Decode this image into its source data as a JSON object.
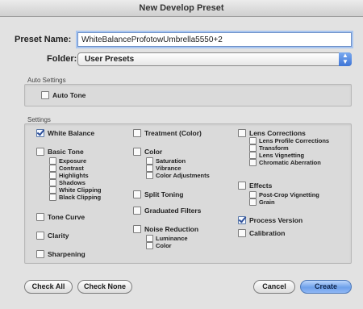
{
  "window": {
    "title": "New Develop Preset"
  },
  "preset_name": {
    "label": "Preset Name:",
    "value": "WhiteBalanceProfotowUmbrella5550+2"
  },
  "folder": {
    "label": "Folder:",
    "value": "User Presets"
  },
  "auto_settings": {
    "title": "Auto Settings",
    "auto_tone": "Auto Tone"
  },
  "settings": {
    "title": "Settings",
    "white_balance": "White Balance",
    "basic_tone": "Basic Tone",
    "exposure": "Exposure",
    "contrast": "Contrast",
    "highlights": "Highlights",
    "shadows": "Shadows",
    "white_clipping": "White Clipping",
    "black_clipping": "Black Clipping",
    "tone_curve": "Tone Curve",
    "clarity": "Clarity",
    "sharpening": "Sharpening",
    "treatment": "Treatment (Color)",
    "color": "Color",
    "saturation": "Saturation",
    "vibrance": "Vibrance",
    "color_adjustments": "Color Adjustments",
    "split_toning": "Split Toning",
    "graduated_filters": "Graduated Filters",
    "noise_reduction": "Noise Reduction",
    "luminance": "Luminance",
    "nr_color": "Color",
    "lens_corrections": "Lens Corrections",
    "lens_profile": "Lens Profile Corrections",
    "transform": "Transform",
    "lens_vignetting": "Lens Vignetting",
    "chromatic_aberration": "Chromatic Aberration",
    "effects": "Effects",
    "post_crop_vignetting": "Post-Crop Vignetting",
    "grain": "Grain",
    "process_version": "Process Version",
    "calibration": "Calibration"
  },
  "buttons": {
    "check_all": "Check All",
    "check_none": "Check None",
    "cancel": "Cancel",
    "create": "Create"
  }
}
